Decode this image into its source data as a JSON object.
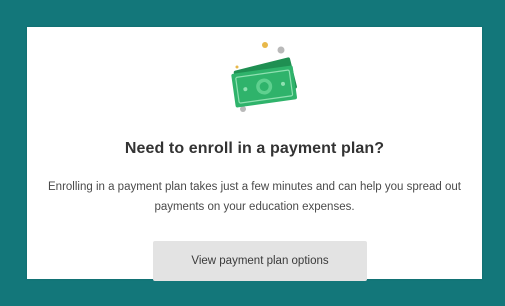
{
  "colors": {
    "frame_teal": "#13777a",
    "card_bg": "#ffffff",
    "money_green": "#2fb36b",
    "money_dark": "#1f8f52",
    "button_bg": "#e3e3e3"
  },
  "illustration": {
    "icon": "cash-bills-icon"
  },
  "card": {
    "title": "Need to enroll in a payment plan?",
    "description": "Enrolling in a payment plan takes just a few minutes and can help you spread out payments on your education expenses.",
    "button_label": "View payment plan options"
  }
}
